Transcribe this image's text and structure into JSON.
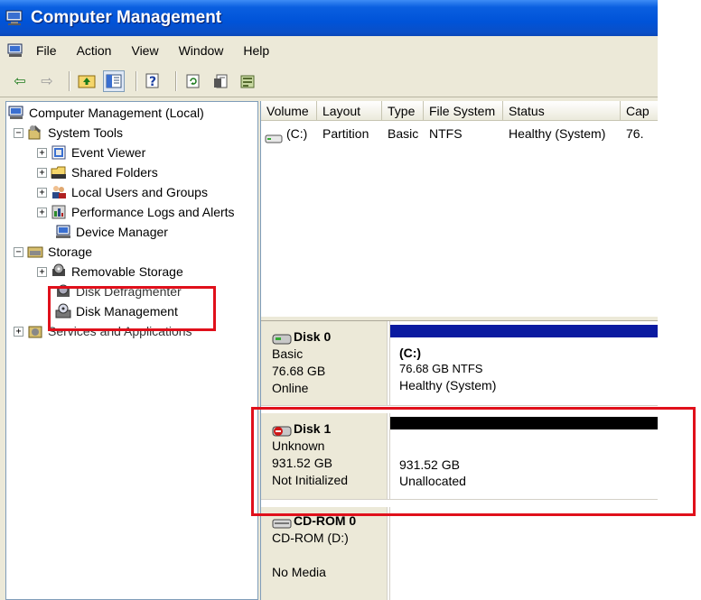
{
  "window": {
    "title": "Computer Management"
  },
  "menubar": {
    "items": [
      "File",
      "Action",
      "View",
      "Window",
      "Help"
    ]
  },
  "tree": [
    {
      "label": "Computer Management (Local)",
      "level": 0,
      "expander": ""
    },
    {
      "label": "System Tools",
      "level": 1,
      "expander": "−"
    },
    {
      "label": "Event Viewer",
      "level": 2,
      "expander": "+"
    },
    {
      "label": "Shared Folders",
      "level": 2,
      "expander": "+"
    },
    {
      "label": "Local Users and Groups",
      "level": 2,
      "expander": "+"
    },
    {
      "label": "Performance Logs and Alerts",
      "level": 2,
      "expander": "+"
    },
    {
      "label": "Device Manager",
      "level": 2,
      "expander": ""
    },
    {
      "label": "Storage",
      "level": 1,
      "expander": "−"
    },
    {
      "label": "Removable Storage",
      "level": 2,
      "expander": "+"
    },
    {
      "label": "Disk Defragmenter",
      "level": 2,
      "expander": ""
    },
    {
      "label": "Disk Management",
      "level": 2,
      "expander": ""
    },
    {
      "label": "Services and Applications",
      "level": 1,
      "expander": "+"
    }
  ],
  "volume_list": {
    "columns": [
      "Volume",
      "Layout",
      "Type",
      "File System",
      "Status",
      "Cap"
    ],
    "rows": [
      {
        "volume": "(C:)",
        "layout": "Partition",
        "type": "Basic",
        "fs": "NTFS",
        "status": "Healthy (System)",
        "cap": "76."
      }
    ]
  },
  "disks": [
    {
      "name": "Disk 0",
      "type": "Basic",
      "size": "76.68 GB",
      "state": "Online",
      "partition": {
        "label": "(C:)",
        "size": "76.68 GB NTFS",
        "status": "Healthy (System)"
      }
    },
    {
      "name": "Disk 1",
      "type": "Unknown",
      "size": "931.52 GB",
      "state": "Not Initialized",
      "partition": {
        "label": "",
        "size": "931.52 GB",
        "status": "Unallocated"
      }
    },
    {
      "name": "CD-ROM 0",
      "type": "CD-ROM (D:)",
      "size": "",
      "state": "No Media"
    }
  ],
  "colors": {
    "titlebar": "#0053d8",
    "primary_partition": "#0a1aa0",
    "unallocated": "#000000",
    "highlight": "#e0101b"
  }
}
